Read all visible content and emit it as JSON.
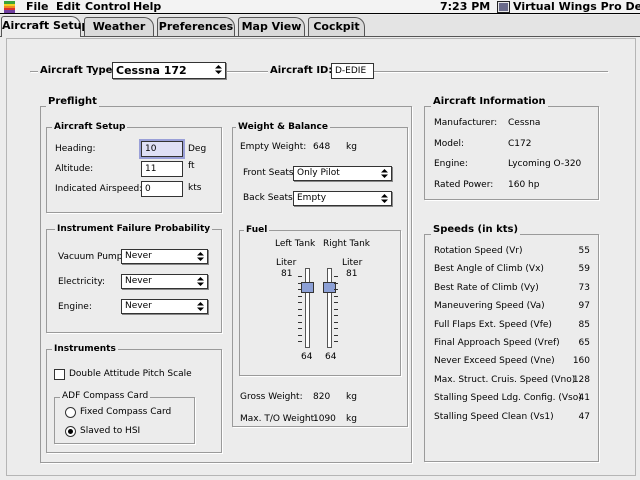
{
  "menubar": {
    "items": [
      "File",
      "Edit",
      "Control",
      "Help"
    ],
    "time": "7:23 PM",
    "app_name": "Virtual Wings Pro Demo",
    "icons": [
      "apple-icon",
      "app-icon"
    ]
  },
  "tabs": [
    {
      "label": "Aircraft Setup",
      "active": true
    },
    {
      "label": "Weather",
      "active": false
    },
    {
      "label": "Preferences",
      "active": false
    },
    {
      "label": "Map View",
      "active": false
    },
    {
      "label": "Cockpit",
      "active": false
    }
  ],
  "aircraft": {
    "type_label": "Aircraft Type:",
    "type_value": "Cessna 172",
    "id_label": "Aircraft ID:",
    "id_value": "D-EDIE"
  },
  "preflight": {
    "title": "Preflight",
    "setup": {
      "title": "Aircraft Setup",
      "heading_label": "Heading:",
      "heading_value": "10",
      "heading_unit": "Deg",
      "altitude_label": "Altitude:",
      "altitude_value": "11",
      "altitude_unit": "ft",
      "ias_label": "Indicated Airspeed:",
      "ias_value": "0",
      "ias_unit": "kts"
    },
    "failure": {
      "title": "Instrument Failure Probability",
      "vacuum_label": "Vacuum Pump:",
      "vacuum_value": "Never",
      "electricity_label": "Electricity:",
      "electricity_value": "Never",
      "engine_label": "Engine:",
      "engine_value": "Never"
    },
    "instruments": {
      "title": "Instruments",
      "double_pitch_label": "Double Attitude Pitch Scale",
      "double_pitch_checked": false,
      "adf_title": "ADF Compass Card",
      "fixed_label": "Fixed Compass Card",
      "slaved_label": "Slaved to HSI",
      "selected": "slaved"
    },
    "weight": {
      "title": "Weight & Balance",
      "empty_label": "Empty Weight:",
      "empty_value": "648",
      "empty_unit": "kg",
      "front_label": "Front Seats:",
      "front_value": "Only Pilot",
      "back_label": "Back Seats:",
      "back_value": "Empty",
      "gross_label": "Gross Weight:",
      "gross_value": "820",
      "gross_unit": "kg",
      "max_label": "Max. T/O Weight:",
      "max_value": "1090",
      "max_unit": "kg"
    },
    "fuel": {
      "title": "Fuel",
      "left_label": "Left Tank",
      "right_label": "Right Tank",
      "left_unit": "Liter",
      "right_unit": "Liter",
      "left_max": "81",
      "right_max": "81",
      "left_value": "64",
      "right_value": "64",
      "left_fraction": 0.79,
      "right_fraction": 0.79
    }
  },
  "info": {
    "title": "Aircraft Information",
    "rows": [
      {
        "label": "Manufacturer:",
        "value": "Cessna"
      },
      {
        "label": "Model:",
        "value": "C172"
      },
      {
        "label": "Engine:",
        "value": "Lycoming O-320"
      },
      {
        "label": "Rated Power:",
        "value": "160 hp"
      }
    ]
  },
  "speeds": {
    "title": "Speeds (in kts)",
    "rows": [
      {
        "label": "Rotation Speed (Vr)",
        "value": "55"
      },
      {
        "label": "Best Angle of Climb (Vx)",
        "value": "59"
      },
      {
        "label": "Best Rate of Climb (Vy)",
        "value": "73"
      },
      {
        "label": "Maneuvering Speed (Va)",
        "value": "97"
      },
      {
        "label": "Full Flaps Ext. Speed (Vfe)",
        "value": "85"
      },
      {
        "label": "Final Approach Speed (Vref)",
        "value": "65"
      },
      {
        "label": "Never Exceed Speed (Vne)",
        "value": "160"
      },
      {
        "label": "Max. Struct. Cruis. Speed (Vno)",
        "value": "128"
      },
      {
        "label": "Stalling Speed Ldg. Config. (Vso)",
        "value": "41"
      },
      {
        "label": "Stalling Speed Clean (Vs1)",
        "value": "47"
      }
    ]
  }
}
